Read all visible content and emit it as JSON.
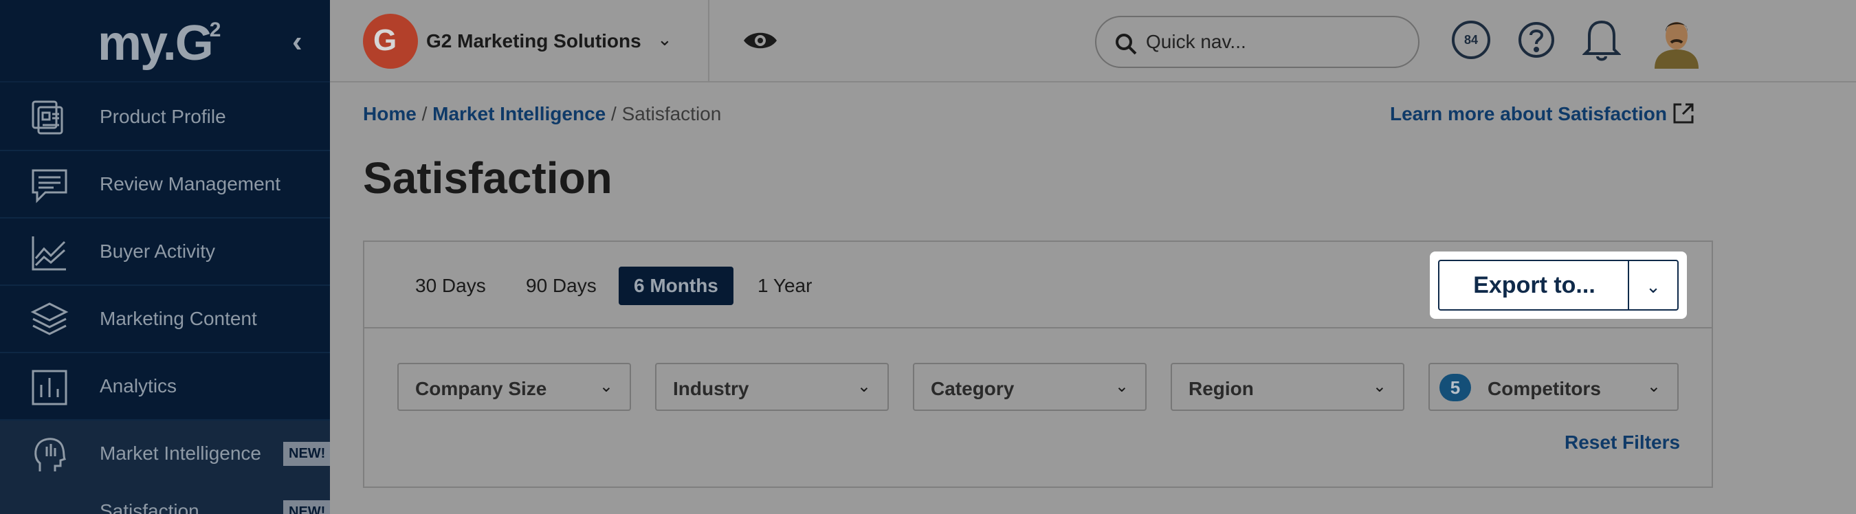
{
  "sidebar": {
    "logo": {
      "text": "my.G",
      "sup": "2"
    },
    "collapse_icon": "chevron-left-icon",
    "items": [
      {
        "label": "Product Profile",
        "icon": "product-profile-icon"
      },
      {
        "label": "Review Management",
        "icon": "chat-icon"
      },
      {
        "label": "Buyer Activity",
        "icon": "chart-line-icon"
      },
      {
        "label": "Marketing Content",
        "icon": "layers-icon"
      },
      {
        "label": "Analytics",
        "icon": "bar-chart-icon"
      },
      {
        "label": "Market Intelligence",
        "icon": "head-icon",
        "badge": "NEW!",
        "active": true
      }
    ],
    "sub_item": {
      "label": "Satisfaction",
      "badge": "NEW!"
    }
  },
  "header": {
    "org_logo_letter": "G",
    "org_name": "G2 Marketing Solutions",
    "search_placeholder": "Quick nav...",
    "score": "84"
  },
  "breadcrumb": {
    "home": "Home",
    "section": "Market Intelligence",
    "current": "Satisfaction",
    "sep": "/"
  },
  "learn_more": "Learn more about Satisfaction",
  "page_title": "Satisfaction",
  "time_ranges": [
    {
      "label": "30 Days",
      "active": false
    },
    {
      "label": "90 Days",
      "active": false
    },
    {
      "label": "6 Months",
      "active": true
    },
    {
      "label": "1 Year",
      "active": false
    }
  ],
  "export": {
    "label": "Export to...",
    "caret": "⌄"
  },
  "filters": [
    {
      "label": "Company Size"
    },
    {
      "label": "Industry"
    },
    {
      "label": "Category"
    },
    {
      "label": "Region"
    },
    {
      "label": "Competitors",
      "count": "5"
    }
  ],
  "reset_filters": "Reset Filters",
  "colors": {
    "sidebar_bg": "#061a33",
    "link": "#0f3a68",
    "active_range": "#061a33",
    "overlay": "#9a9a9a"
  }
}
